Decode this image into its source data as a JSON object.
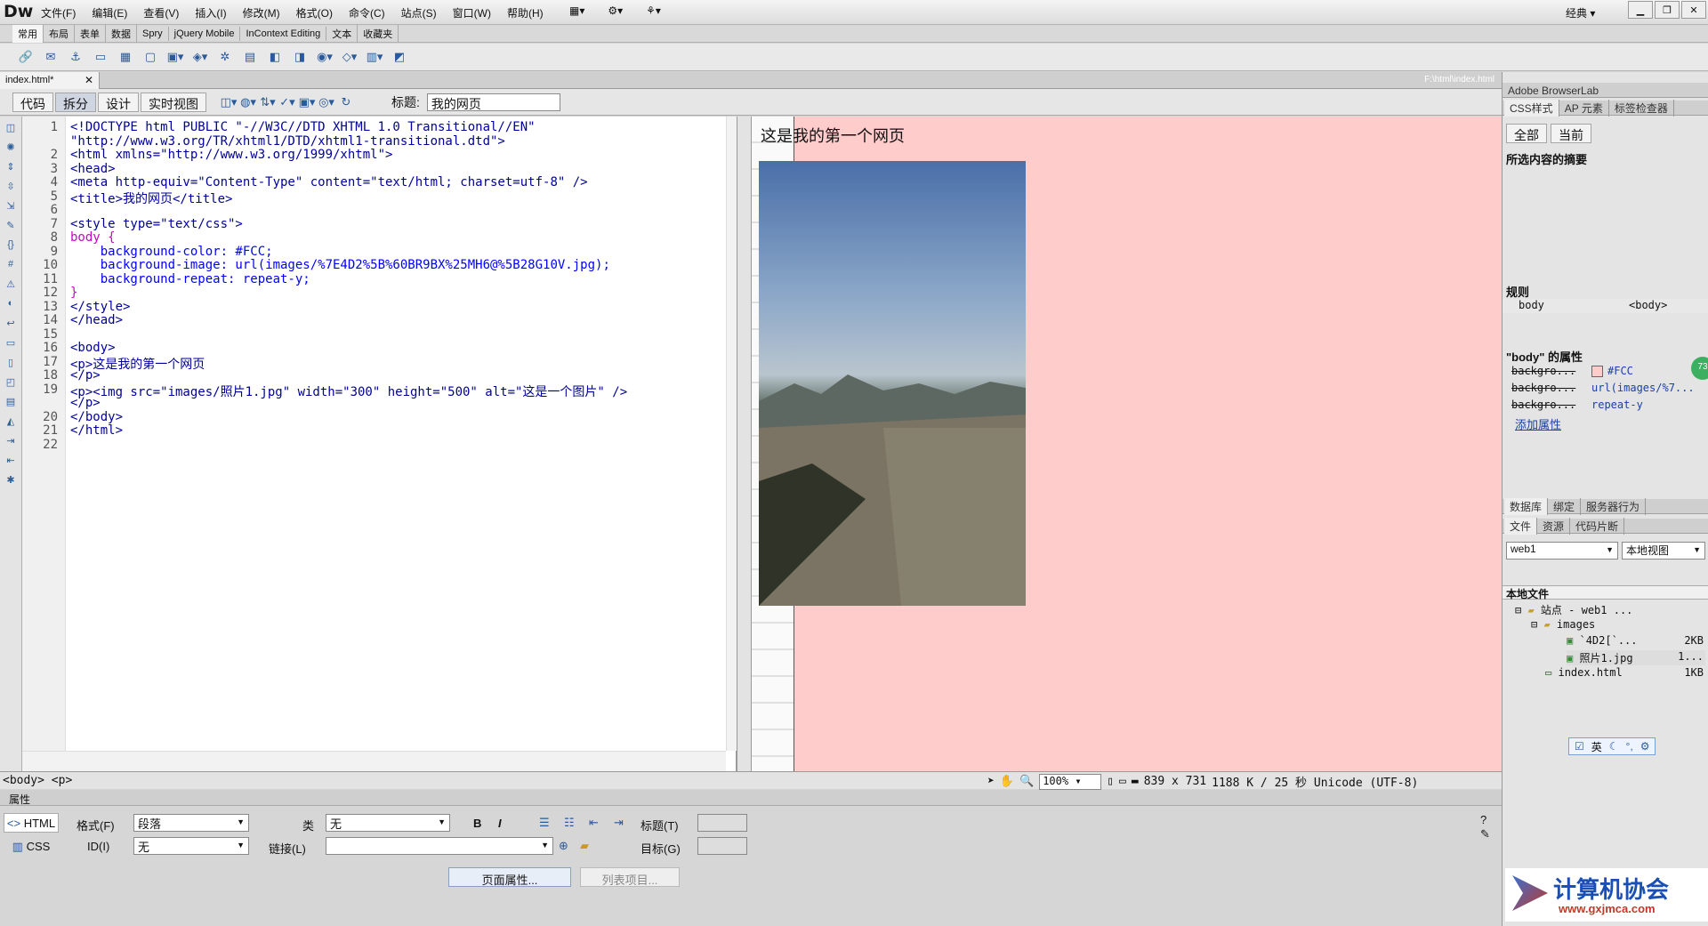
{
  "app": {
    "logo": "Dw",
    "workspace": "经典"
  },
  "menu": [
    "文件(F)",
    "编辑(E)",
    "查看(V)",
    "插入(I)",
    "修改(M)",
    "格式(O)",
    "命令(C)",
    "站点(S)",
    "窗口(W)",
    "帮助(H)"
  ],
  "insert_tabs": [
    "常用",
    "布局",
    "表单",
    "数据",
    "Spry",
    "jQuery Mobile",
    "InContext Editing",
    "文本",
    "收藏夹"
  ],
  "document": {
    "tab": "index.html*",
    "path": "F:\\html\\index.html",
    "views": [
      "代码",
      "拆分",
      "设计",
      "实时视图"
    ],
    "title_label": "标题:",
    "title_value": "我的网页"
  },
  "code_lines": [
    {
      "n": "1",
      "t": "<!DOCTYPE html PUBLIC \"-//W3C//DTD XHTML 1.0 Transitional//EN\""
    },
    {
      "n": "",
      "t": "\"http://www.w3.org/TR/xhtml1/DTD/xhtml1-transitional.dtd\">"
    },
    {
      "n": "2",
      "t": "<html xmlns=\"http://www.w3.org/1999/xhtml\">"
    },
    {
      "n": "3",
      "t": "<head>"
    },
    {
      "n": "4",
      "t": "<meta http-equiv=\"Content-Type\" content=\"text/html; charset=utf-8\" />"
    },
    {
      "n": "5",
      "t": "<title>我的网页</title>"
    },
    {
      "n": "6",
      "t": ""
    },
    {
      "n": "7",
      "t": "<style type=\"text/css\">"
    },
    {
      "n": "8",
      "t": "body {"
    },
    {
      "n": "9",
      "t": "    background-color: #FCC;"
    },
    {
      "n": "10",
      "t": "    background-image: url(images/%7E4D2%5B%60BR9BX%25MH6@%5B28G10V.jpg);"
    },
    {
      "n": "11",
      "t": "    background-repeat: repeat-y;"
    },
    {
      "n": "12",
      "t": "}"
    },
    {
      "n": "13",
      "t": "</style>"
    },
    {
      "n": "14",
      "t": "</head>"
    },
    {
      "n": "15",
      "t": ""
    },
    {
      "n": "16",
      "t": "<body>"
    },
    {
      "n": "17",
      "t": "<p>这是我的第一个网页"
    },
    {
      "n": "18",
      "t": "</p>"
    },
    {
      "n": "19",
      "t": "<p><img src=\"images/照片1.jpg\" width=\"300\" height=\"500\" alt=\"这是一个图片\" />"
    },
    {
      "n": "",
      "t": "</p>"
    },
    {
      "n": "20",
      "t": "</body>"
    },
    {
      "n": "21",
      "t": "</html>"
    },
    {
      "n": "22",
      "t": ""
    }
  ],
  "design": {
    "paragraph": "这是我的第一个网页"
  },
  "status": {
    "tag_selector": "<body> <p>",
    "zoom": "100%",
    "window_size": "839 x 731",
    "file_info": "1188 K / 25 秒 Unicode (UTF-8)"
  },
  "properties": {
    "title": "属性",
    "html_btn": "HTML",
    "css_btn": "CSS",
    "format_label": "格式(F)",
    "format_value": "段落",
    "class_label": "类",
    "class_value": "无",
    "id_label": "ID(I)",
    "id_value": "无",
    "link_label": "链接(L)",
    "link_value": "",
    "heading_label": "标题(T)",
    "target_label": "目标(G)",
    "bold": "B",
    "italic": "I",
    "page_props_btn": "页面属性...",
    "list_item_btn": "列表项目..."
  },
  "right_panel": {
    "browserlab": "Adobe BrowserLab",
    "css_tabs": [
      "CSS样式",
      "AP 元素",
      "标签检查器"
    ],
    "mode_buttons": [
      "全部",
      "当前"
    ],
    "summary_title": "所选内容的摘要",
    "rules_title": "规则",
    "rule_selector": "body",
    "rule_tag": "<body>",
    "props_title": "\"body\" 的属性",
    "props": [
      {
        "k": "backgro...",
        "v": "#FCC"
      },
      {
        "k": "backgro...",
        "v": "url(images/%7..."
      },
      {
        "k": "backgro...",
        "v": "repeat-y"
      }
    ],
    "add_property": "添加属性",
    "badge": "73",
    "db_tabs": [
      "数据库",
      "绑定",
      "服务器行为"
    ],
    "file_tabs": [
      "文件",
      "资源",
      "代码片断"
    ],
    "site": "web1",
    "view": "本地视图",
    "local_files": "本地文件",
    "tree": [
      {
        "label": "站点 - web1 ...",
        "size": ""
      },
      {
        "label": "images",
        "size": ""
      },
      {
        "label": "`4D2[`...",
        "size": "2KB"
      },
      {
        "label": "照片1.jpg",
        "size": "1..."
      },
      {
        "label": "index.html",
        "size": "1KB"
      }
    ],
    "ime": "英",
    "watermark": "计算机协会",
    "watermark_url": "www.gxjmca.com"
  }
}
